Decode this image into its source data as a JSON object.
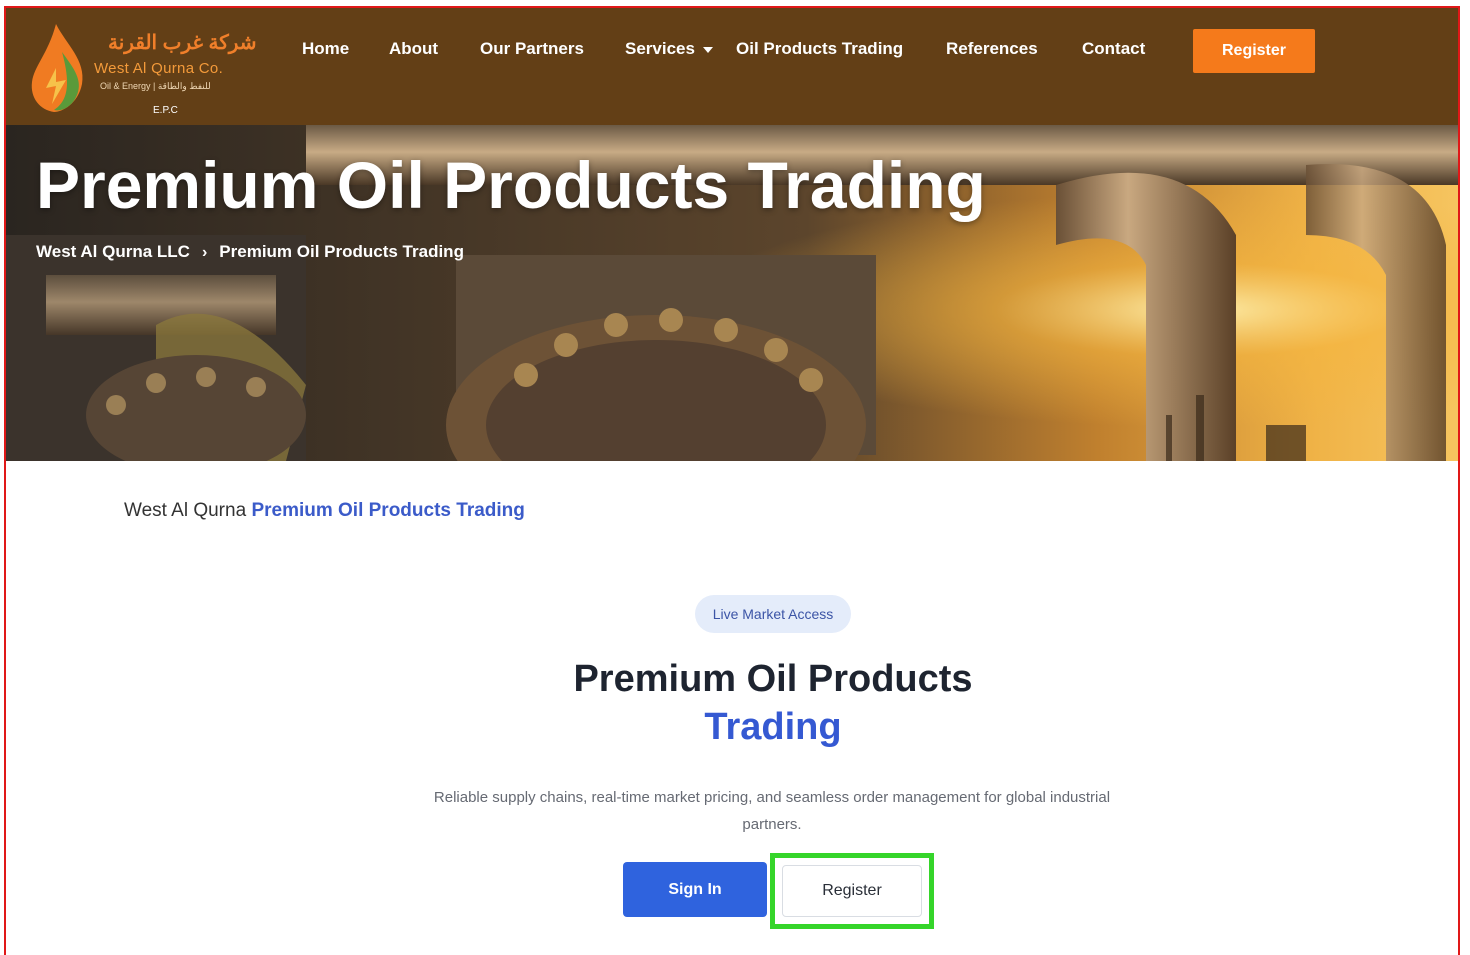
{
  "brand": {
    "arabic_name": "شركة غرب القرنة",
    "english_name": "West Al Qurna Co.",
    "tagline": "Oil & Energy | للنفط والطاقة",
    "suffix": "E.P.C"
  },
  "nav": {
    "items": [
      {
        "label": "Home"
      },
      {
        "label": "About"
      },
      {
        "label": "Our Partners"
      },
      {
        "label": "Services",
        "has_dropdown": true
      },
      {
        "label": "Oil Products Trading"
      },
      {
        "label": "References"
      },
      {
        "label": "Contact"
      }
    ],
    "register_label": "Register"
  },
  "hero": {
    "title": "Premium Oil Products Trading",
    "breadcrumb": {
      "home": "West Al Qurna LLC",
      "separator": "›",
      "current": "Premium Oil Products Trading"
    }
  },
  "intro": {
    "prefix": "West Al Qurna",
    "link": "Premium Oil Products Trading"
  },
  "section": {
    "badge": "Live Market Access",
    "heading_main": "Premium Oil Products",
    "heading_accent": "Trading",
    "description": "Reliable supply chains, real-time market pricing, and seamless order management for global industrial partners.",
    "signin_label": "Sign In",
    "register_label": "Register"
  },
  "colors": {
    "header_bg": "#633f16",
    "register_orange": "#f57a1b",
    "accent_blue": "#3559d2",
    "highlight_green": "#35d52a",
    "frame_red": "#e01818"
  }
}
